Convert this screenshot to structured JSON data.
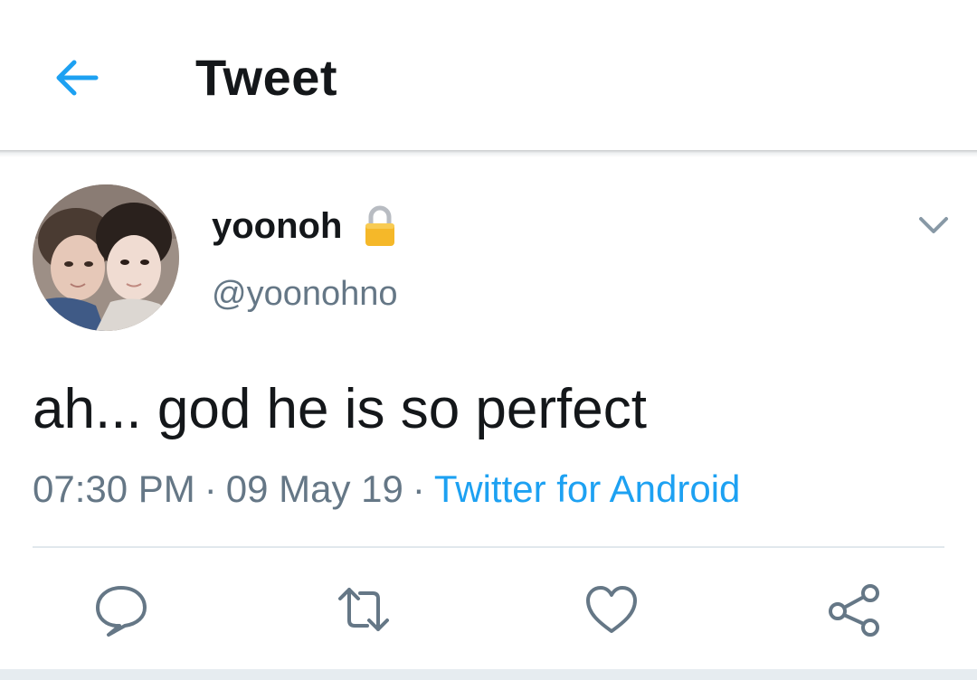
{
  "header": {
    "title": "Tweet",
    "back_icon": "arrow-left-icon",
    "accent_color": "#1da1f2"
  },
  "tweet": {
    "display_name": "yoonoh",
    "protected_icon": "lock-icon",
    "handle": "@yoonohno",
    "text": "ah... god he is so perfect",
    "time": "07:30 PM",
    "date": "09 May 19",
    "source": "Twitter for Android",
    "separator": "·",
    "menu_icon": "chevron-down-icon"
  },
  "actions": [
    {
      "name": "reply",
      "icon": "comment-icon"
    },
    {
      "name": "retweet",
      "icon": "retweet-icon"
    },
    {
      "name": "like",
      "icon": "heart-icon"
    },
    {
      "name": "share",
      "icon": "share-icon"
    }
  ],
  "colors": {
    "text": "#14171a",
    "secondary": "#657786",
    "link": "#1da1f2",
    "divider": "#e1e8ed"
  }
}
